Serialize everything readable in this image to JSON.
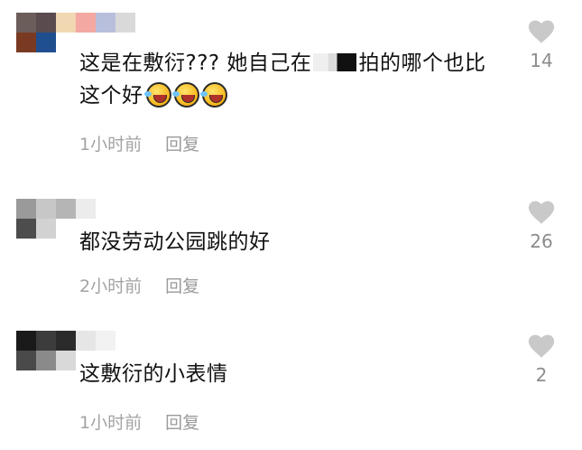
{
  "comments": [
    {
      "text_before": "这是在敷衍??? 她自己在",
      "text_after": "拍的哪个也比这个好",
      "emoji_count": 3,
      "time": "1小时前",
      "reply_label": "回复",
      "likes": "14",
      "avatar_colors": [
        "#6b5e5a",
        "#5a4b4e",
        "#f1d7b2",
        "#f4a8a2",
        "#b8bfdc",
        "#d9d9d9",
        "#7a3a22",
        "#1f4f8f",
        "#ffffff",
        "#ffffff",
        "#ffffff",
        "#ffffff"
      ]
    },
    {
      "text": "都没劳动公园跳的好",
      "time": "2小时前",
      "reply_label": "回复",
      "likes": "26",
      "avatar_colors": [
        "#9a9a9a",
        "#c7c7c7",
        "#b5b5b5",
        "#ececec",
        "#4d4d4d",
        "#d2d2d2",
        "#ffffff",
        "#ffffff"
      ]
    },
    {
      "text": "这敷衍的小表情",
      "time": "1小时前",
      "reply_label": "回复",
      "likes": "2",
      "avatar_colors": [
        "#1a1a1a",
        "#3c3c3c",
        "#2b2b2b",
        "#e6e6e6",
        "#f2f2f2",
        "#4a4a4a",
        "#8a8a8a",
        "#d9d9d9",
        "#ffffff",
        "#ffffff"
      ]
    }
  ],
  "colors": {
    "text": "#111111",
    "meta": "#a3a3a3",
    "heart": "#c9c9c9",
    "like_count": "#8c8c8c"
  },
  "icons": {
    "like": "heart-icon",
    "emoji": "laughing-crying-emoji-icon"
  }
}
